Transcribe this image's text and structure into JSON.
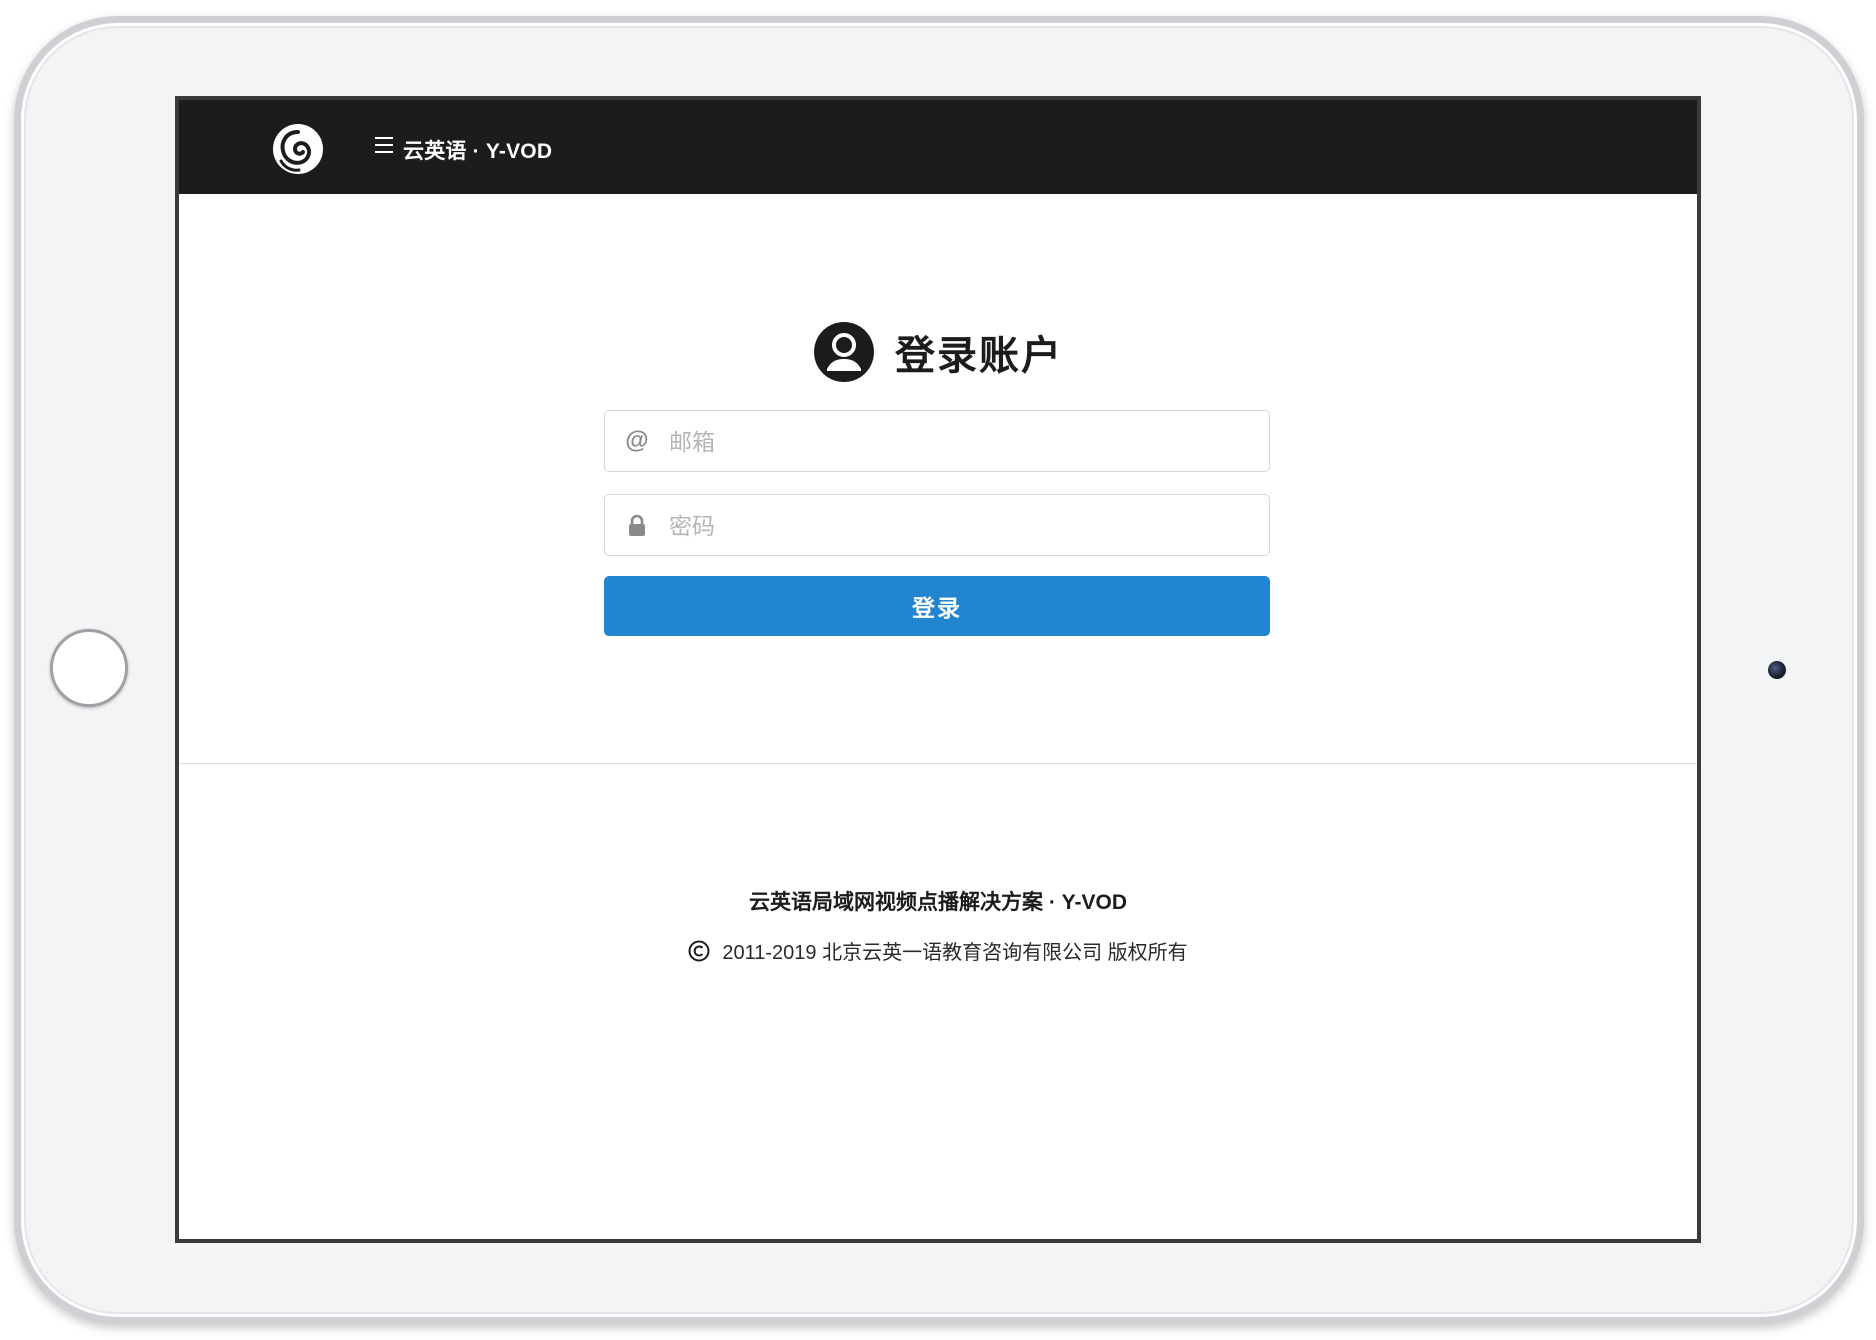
{
  "header": {
    "app_title": "云英语 · Y-VOD"
  },
  "login": {
    "title": "登录账户",
    "email_placeholder": "邮箱",
    "email_icon": "@",
    "password_placeholder": "密码",
    "submit_label": "登录"
  },
  "footer": {
    "product_name": "云英语局域网视频点播解决方案 · Y-VOD",
    "copyright": "2011-2019 北京云英一语教育咨询有限公司 版权所有"
  },
  "colors": {
    "topbar": "#1c1c1c",
    "accent": "#2185d0",
    "text": "#1c1c1c"
  },
  "icons": {
    "logo": "swirl-logo-icon",
    "menu": "hamburger-menu-icon",
    "user": "user-circle-icon",
    "email": "at-sign-icon",
    "password": "lock-icon",
    "copyright": "copyright-icon"
  }
}
